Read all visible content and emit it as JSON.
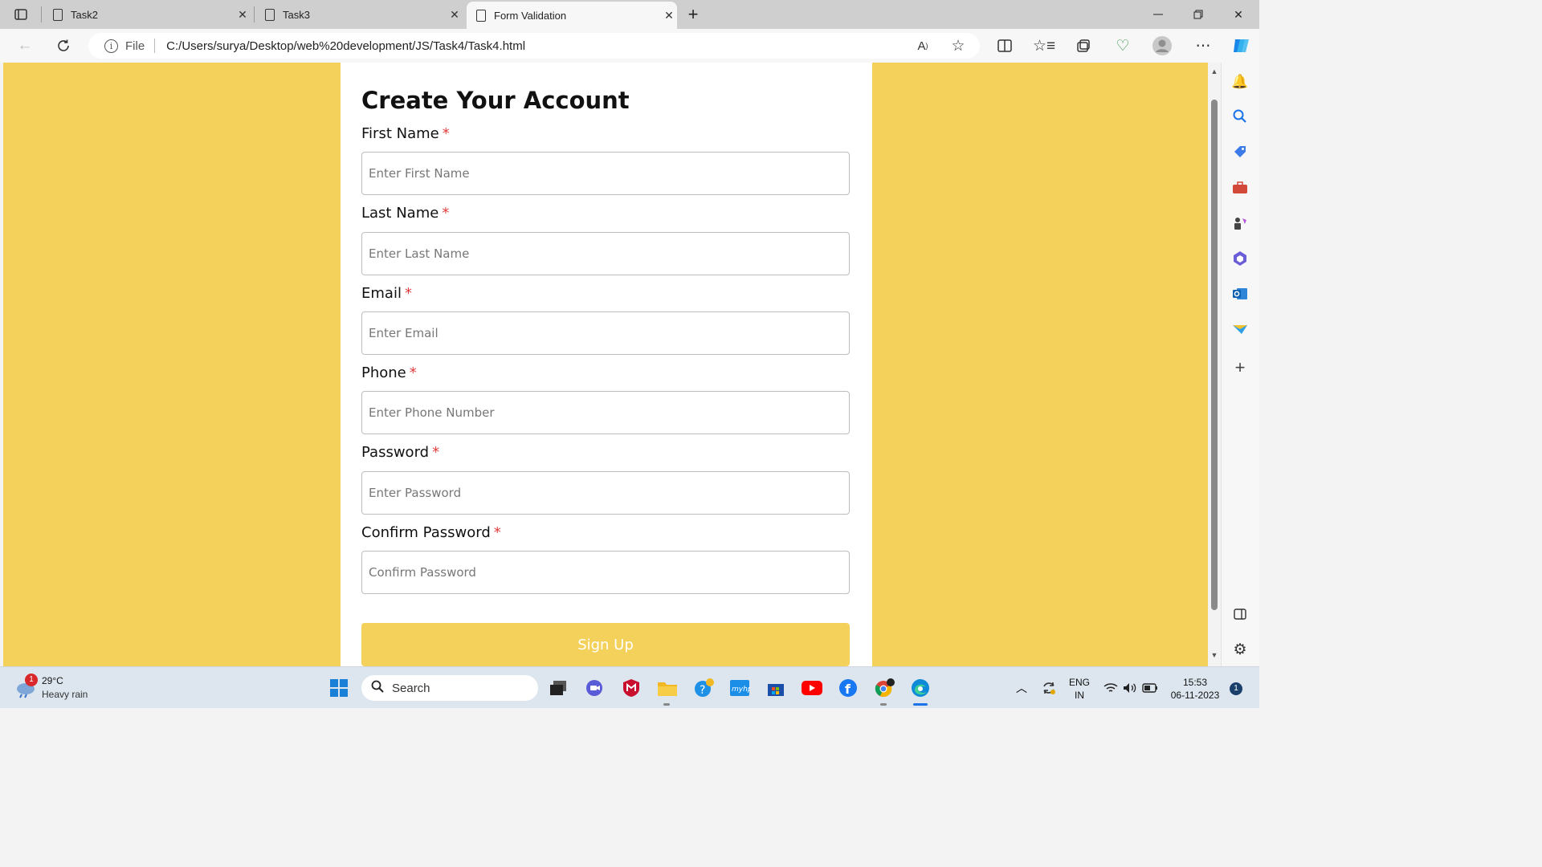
{
  "browser": {
    "tabs": [
      {
        "title": "Task2",
        "active": false
      },
      {
        "title": "Task3",
        "active": false
      },
      {
        "title": "Form Validation",
        "active": true
      }
    ],
    "url_scheme": "File",
    "url": "C:/Users/surya/Desktop/web%20development/JS/Task4/Task4.html"
  },
  "form": {
    "title": "Create Your Account",
    "required_mark": "*",
    "fields": [
      {
        "label": "First Name",
        "placeholder": "Enter First Name"
      },
      {
        "label": "Last Name",
        "placeholder": "Enter Last Name"
      },
      {
        "label": "Email",
        "placeholder": "Enter Email"
      },
      {
        "label": "Phone",
        "placeholder": "Enter Phone Number"
      },
      {
        "label": "Password",
        "placeholder": "Enter Password"
      },
      {
        "label": "Confirm Password",
        "placeholder": "Confirm Password"
      }
    ],
    "submit_label": "Sign Up"
  },
  "colors": {
    "page_background": "#f4d15a",
    "card": "#ffffff",
    "required": "#e23b3b",
    "button": "#f4d15a"
  },
  "taskbar": {
    "weather_badge": "1",
    "temperature": "29°C",
    "weather": "Heavy rain",
    "search_label": "Search",
    "language_line1": "ENG",
    "language_line2": "IN",
    "time": "15:53",
    "date": "06-11-2023",
    "notification_count": "1"
  }
}
